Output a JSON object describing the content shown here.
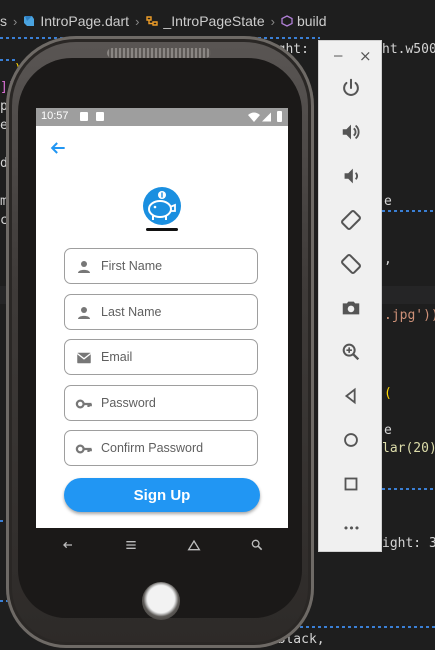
{
  "ide": {
    "breadcrumb": {
      "prefix": "s",
      "file": "IntroPage.dart",
      "class_name": "_IntroPageState",
      "method": "build"
    },
    "code_fragments": {
      "weight": "eight:",
      "w500": "ht.w500",
      "jpg": ".jpg'))",
      "e1": "e",
      "e2": "e",
      "e3": "e",
      "lar": "lar(20)",
      "i": "i",
      "paren": "(",
      "fight": "f",
      "ight": "ight: 3",
      "r": "r",
      "black": "s.black,",
      "pa": "pa",
      "el": "el",
      "dy": "dy",
      "ma": "ma",
      "ch": "ch",
      "bracket": "])",
      "brace": ")"
    },
    "colors": {
      "accent_blue": "#3a7fd5",
      "string_orange": "#ce9178",
      "keyword_yellow": "#dcdcaa"
    }
  },
  "emulator_toolbar": {
    "minimize_label": "–",
    "close_label": "×",
    "buttons": [
      {
        "name": "power-button",
        "icon": "power-icon"
      },
      {
        "name": "volume-up-button",
        "icon": "volume-up-icon"
      },
      {
        "name": "volume-down-button",
        "icon": "volume-down-icon"
      },
      {
        "name": "rotate-left-button",
        "icon": "rotate-left-icon"
      },
      {
        "name": "rotate-right-button",
        "icon": "rotate-right-icon"
      },
      {
        "name": "screenshot-button",
        "icon": "camera-icon"
      },
      {
        "name": "zoom-button",
        "icon": "zoom-in-icon"
      },
      {
        "name": "back-button",
        "icon": "triangle-back-icon"
      },
      {
        "name": "home-button",
        "icon": "circle-home-icon"
      },
      {
        "name": "overview-button",
        "icon": "square-overview-icon"
      },
      {
        "name": "more-button",
        "icon": "more-icon"
      }
    ],
    "more_label": "•••"
  },
  "phone": {
    "status_bar": {
      "time": "10:57",
      "icons": [
        "notification-a-icon",
        "sd-card-icon",
        "wifi-icon",
        "signal-icon",
        "battery-icon"
      ]
    },
    "app": {
      "back_icon": "arrow-back-icon",
      "logo_icon": "piggy-bank-icon",
      "fields": [
        {
          "name": "first-name-field",
          "icon": "person-icon",
          "placeholder": "First Name"
        },
        {
          "name": "last-name-field",
          "icon": "person-icon",
          "placeholder": "Last Name"
        },
        {
          "name": "email-field",
          "icon": "mail-icon",
          "placeholder": "Email"
        },
        {
          "name": "password-field",
          "icon": "key-icon",
          "placeholder": "Password"
        },
        {
          "name": "confirm-password-field",
          "icon": "key-icon",
          "placeholder": "Confirm Password"
        }
      ],
      "signup_label": "Sign Up",
      "colors": {
        "primary": "#2196f3",
        "status_bar": "#9e9e9e"
      }
    },
    "navbar": [
      "back-nav-icon",
      "menu-nav-icon",
      "home-nav-icon",
      "search-nav-icon"
    ]
  }
}
